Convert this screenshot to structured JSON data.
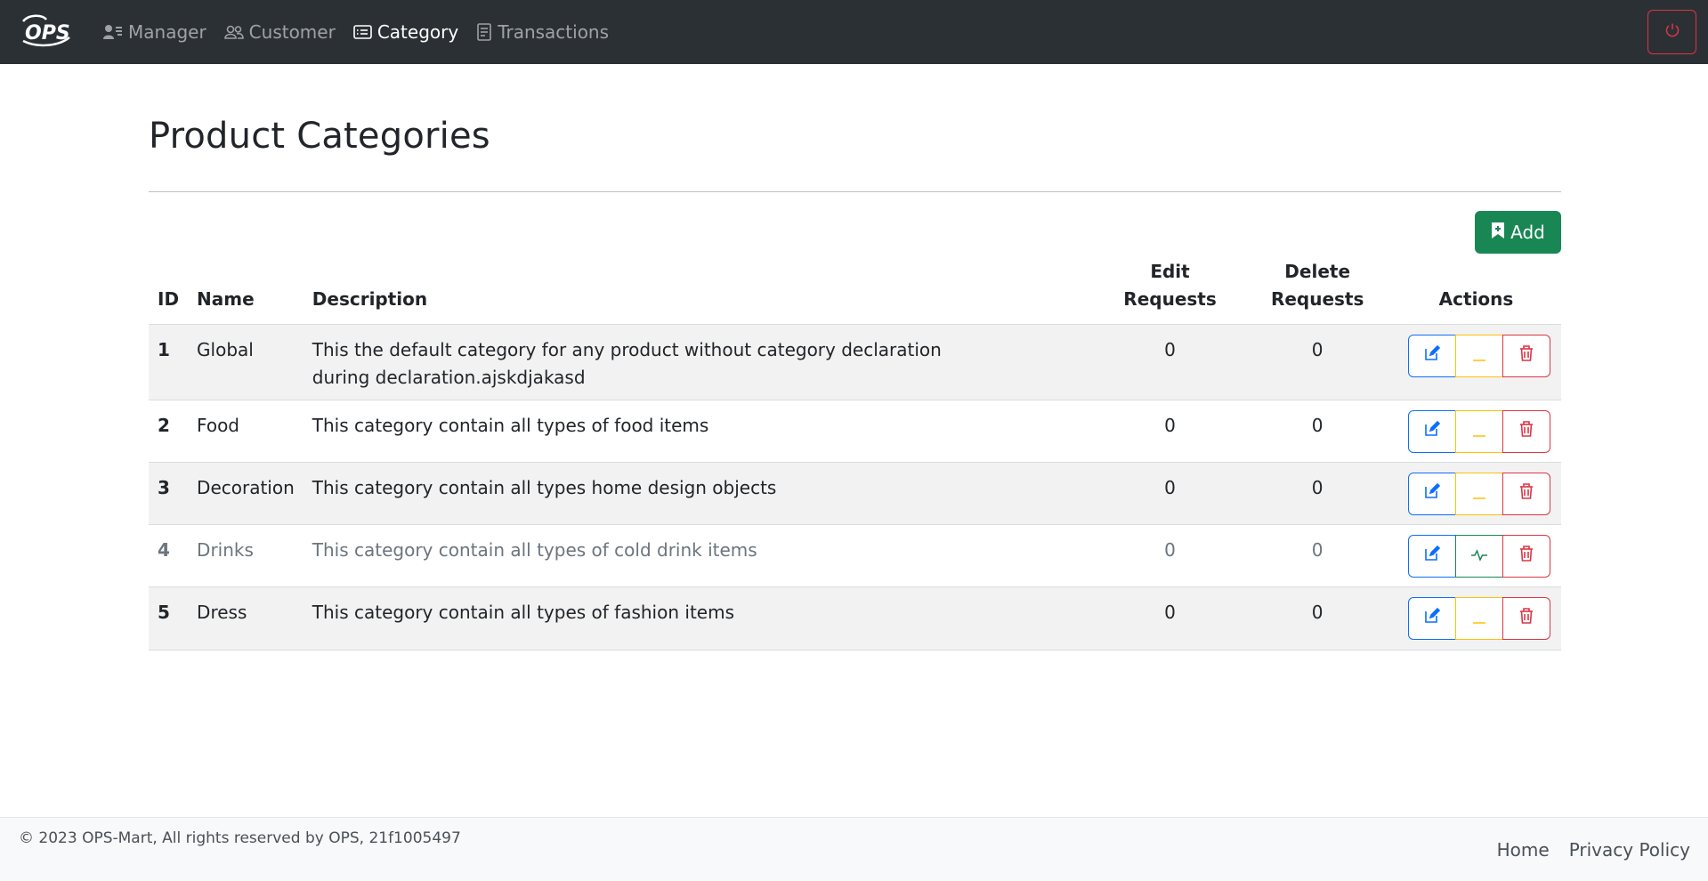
{
  "navbar": {
    "brand": "OPS",
    "links": [
      {
        "label": "Manager",
        "icon": "person-lines-icon",
        "active": false
      },
      {
        "label": "Customer",
        "icon": "people-icon",
        "active": false
      },
      {
        "label": "Category",
        "icon": "card-list-icon",
        "active": true
      },
      {
        "label": "Transactions",
        "icon": "journal-text-icon",
        "active": false
      }
    ],
    "power_icon": "power-icon"
  },
  "main": {
    "title": "Product Categories",
    "add_label": "Add",
    "table": {
      "headers": {
        "id": "ID",
        "name": "Name",
        "description": "Description",
        "edit_requests_1": "Edit",
        "edit_requests_2": "Requests",
        "delete_requests_1": "Delete",
        "delete_requests_2": "Requests",
        "actions": "Actions"
      },
      "rows": [
        {
          "id": "1",
          "name": "Global",
          "description": "This the default category for any product without category declaration during declaration.ajskdjakasd",
          "edit_requests": "0",
          "delete_requests": "0",
          "active": true,
          "toggle_icon": "dash-icon"
        },
        {
          "id": "2",
          "name": "Food",
          "description": "This category contain all types of food items",
          "edit_requests": "0",
          "delete_requests": "0",
          "active": true,
          "toggle_icon": "dash-icon"
        },
        {
          "id": "3",
          "name": "Decoration",
          "description": "This category contain all types home design objects",
          "edit_requests": "0",
          "delete_requests": "0",
          "active": true,
          "toggle_icon": "dash-icon"
        },
        {
          "id": "4",
          "name": "Drinks",
          "description": "This category contain all types of cold drink items",
          "edit_requests": "0",
          "delete_requests": "0",
          "active": false,
          "toggle_icon": "activity-icon"
        },
        {
          "id": "5",
          "name": "Dress",
          "description": "This category contain all types of fashion items",
          "edit_requests": "0",
          "delete_requests": "0",
          "active": true,
          "toggle_icon": "dash-icon"
        }
      ]
    }
  },
  "footer": {
    "copyright": "© 2023 OPS-Mart, All rights reserved by OPS, 21f1005497",
    "links": [
      "Home",
      "Privacy Policy"
    ]
  },
  "colors": {
    "navbar_bg": "#2b3035",
    "success": "#198754",
    "primary": "#0d6efd",
    "warning": "#ffc107",
    "danger": "#dc3545"
  }
}
